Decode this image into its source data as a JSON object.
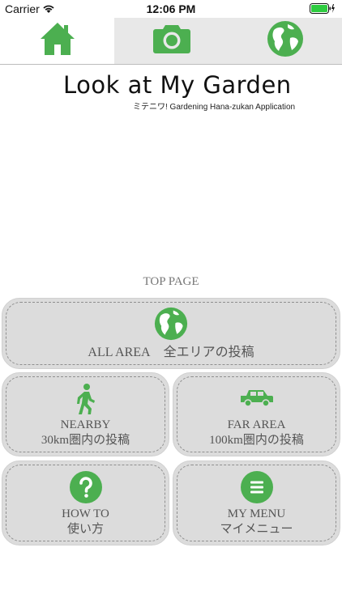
{
  "status": {
    "carrier": "Carrier",
    "time": "12:06 PM"
  },
  "tabs": [
    {
      "name": "home",
      "icon": "home-icon",
      "selected": true
    },
    {
      "name": "camera",
      "icon": "camera-icon",
      "selected": false
    },
    {
      "name": "globe",
      "icon": "globe-icon",
      "selected": false
    }
  ],
  "header": {
    "title": "Look at My Garden",
    "subtitle": "ミテニワ! Gardening Hana-zukan Application"
  },
  "top_page_label": "TOP PAGE",
  "menu": {
    "all_area": {
      "en": "ALL AREA",
      "ja": "全エリアの投稿",
      "icon": "globe-icon"
    },
    "nearby": {
      "en": "NEARBY",
      "ja": "30km圏内の投稿",
      "icon": "walking-person-icon"
    },
    "far_area": {
      "en": "FAR AREA",
      "ja": "100km圏内の投稿",
      "icon": "car-icon"
    },
    "how_to": {
      "en": "HOW TO",
      "ja": "使い方",
      "icon": "help-icon"
    },
    "my_menu": {
      "en": "MY MENU",
      "ja": "マイメニュー",
      "icon": "menu-icon"
    }
  },
  "colors": {
    "accent_green": "#4caf50",
    "button_bg": "#dcdcdc",
    "tab_bg": "#e8e8e8"
  }
}
